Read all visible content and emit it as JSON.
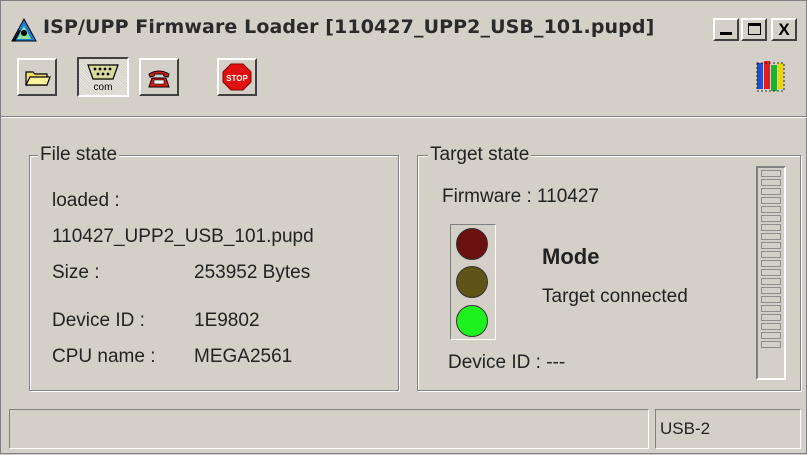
{
  "window": {
    "title": "ISP/UPP Firmware Loader [110427_UPP2_USB_101.pupd]",
    "controls": {
      "minimize": "_",
      "maximize": "",
      "close": "X"
    }
  },
  "toolbar": {
    "buttons": [
      {
        "name": "open-file",
        "icon": "folder-icon"
      },
      {
        "name": "com-port",
        "icon": "serial-port-icon",
        "label": "com",
        "pressed": true
      },
      {
        "name": "connect",
        "icon": "telephone-icon"
      },
      {
        "name": "stop",
        "icon": "stop-sign-icon",
        "label": "STOP"
      }
    ],
    "logo_icon": "app-logo-icon"
  },
  "file_state": {
    "title": "File state",
    "loaded_label": "loaded :",
    "filename": "110427_UPP2_USB_101.pupd",
    "size_label": "Size :",
    "size_value": "253952 Bytes",
    "device_id_label": "Device ID :",
    "device_id_value": "1E9802",
    "cpu_label": "CPU name :",
    "cpu_value": "MEGA2561"
  },
  "target_state": {
    "title": "Target state",
    "firmware": "Firmware : 110427",
    "mode_title": "Mode",
    "mode_status": "Target connected",
    "device_id": "Device ID : ---",
    "traffic_light": {
      "active": "green",
      "red": "#6a1010",
      "yellow": "#5e5418",
      "green": "#1ef21e"
    },
    "progress_fraction": 0,
    "led_segments": 20
  },
  "statusbar": {
    "message": "",
    "connection": "USB-2"
  }
}
